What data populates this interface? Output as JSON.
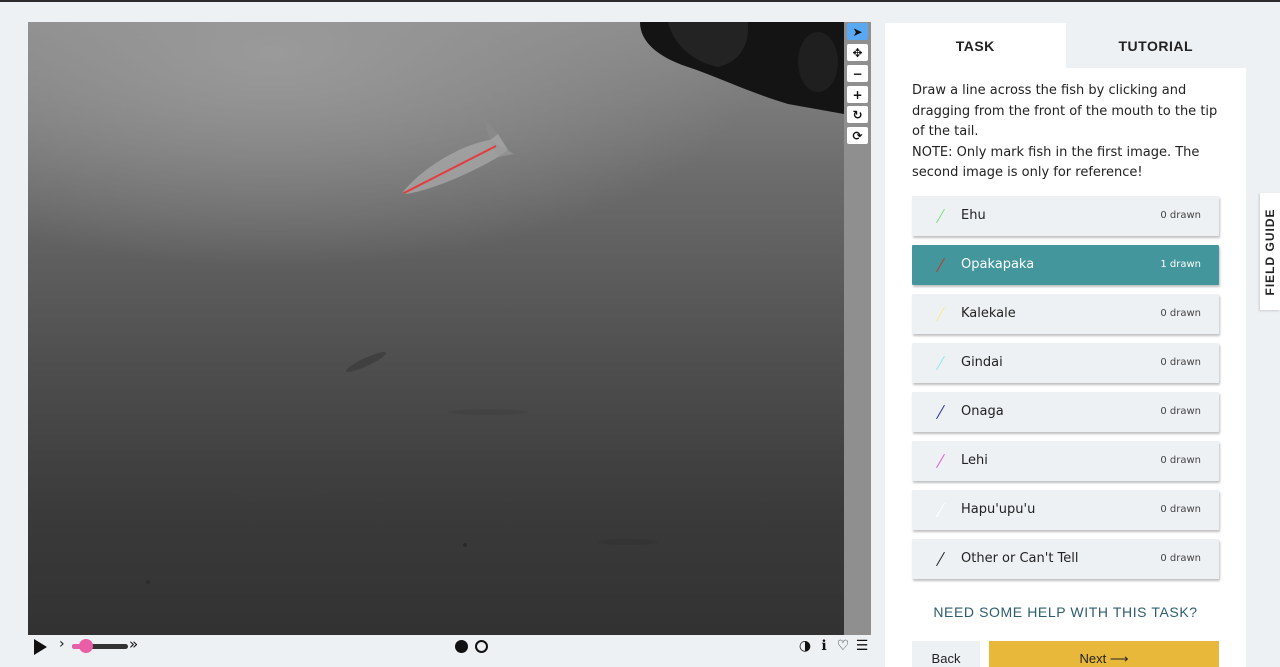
{
  "viewer": {
    "tools": [
      "pointer-icon",
      "move-icon",
      "zoom-out-icon",
      "zoom-in-icon",
      "rotate-icon",
      "reset-icon"
    ],
    "controls": {
      "slow_symbol": "›",
      "fast_symbol": "»",
      "speed_fraction": 0.25,
      "frames": [
        "frame-1-filled",
        "frame-2-empty"
      ],
      "right_icons": [
        "◑",
        "ℹ",
        "♡",
        "☰"
      ]
    }
  },
  "panel": {
    "tabs": [
      {
        "label": "TASK"
      },
      {
        "label": "TUTORIAL"
      }
    ],
    "instructions": [
      "Draw a line across the fish by clicking and dragging from the front of the mouth to the tip of the tail.",
      "NOTE: Only mark fish in the first image. The second image is only for reference!"
    ],
    "choices": [
      {
        "label": "Ehu",
        "count": "0 drawn",
        "color": "#7ee07e"
      },
      {
        "label": "Opakapaka",
        "count": "1 drawn",
        "color": "#c0392b"
      },
      {
        "label": "Kalekale",
        "count": "0 drawn",
        "color": "#f1ee8e"
      },
      {
        "label": "Gindai",
        "count": "0 drawn",
        "color": "#8ee8f0"
      },
      {
        "label": "Onaga",
        "count": "0 drawn",
        "color": "#2233aa"
      },
      {
        "label": "Lehi",
        "count": "0 drawn",
        "color": "#e05ad8"
      },
      {
        "label": "Hapu'upu'u",
        "count": "0 drawn",
        "color": "#ffffff"
      },
      {
        "label": "Other or Can't Tell",
        "count": "0 drawn",
        "color": "#222222"
      }
    ],
    "help_text": "NEED SOME HELP WITH THIS TASK?",
    "back_label": "Back",
    "next_label": "Next ⟶"
  },
  "field_guide_label": "FIELD GUIDE",
  "colors": {
    "accent": "#43969b",
    "next": "#e7b83a",
    "slider": "#e85fa8",
    "active_tool": "#5aa7f2"
  }
}
